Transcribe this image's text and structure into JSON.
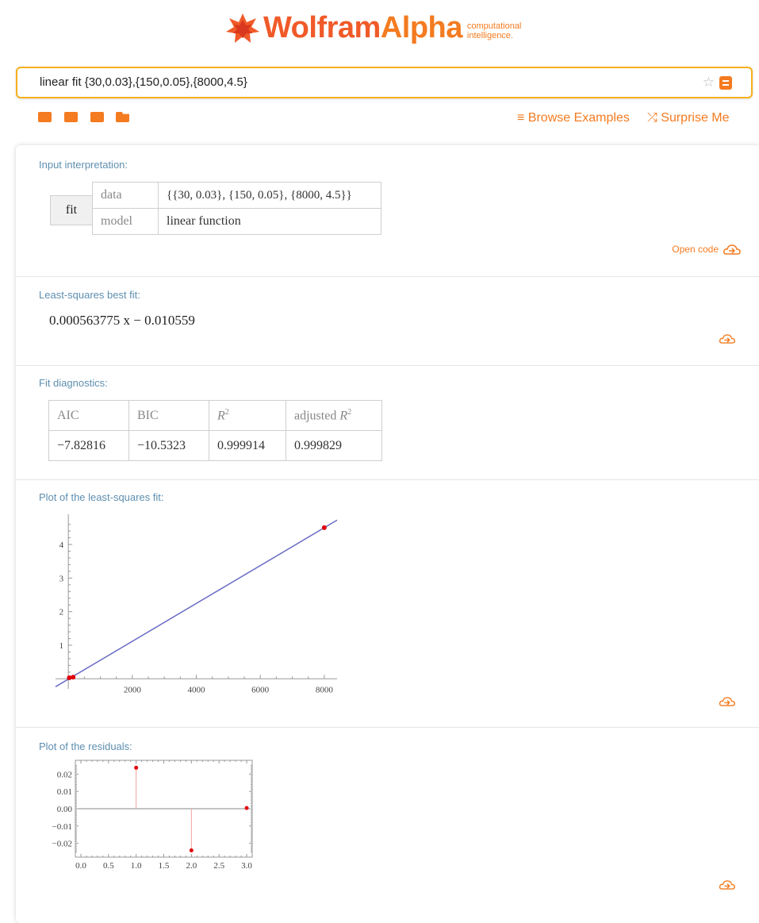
{
  "header": {
    "logo_word_1": "Wolfram",
    "logo_word_2": "Alpha",
    "tagline_1": "computational",
    "tagline_2": "intelligence.",
    "brand_color": "#f05a28",
    "accent_color": "#f47b20"
  },
  "search": {
    "value": "linear fit {30,0.03},{150,0.05},{8000,4.5}"
  },
  "toolbar": {
    "icons": [
      "keyboard-icon",
      "camera-icon",
      "table-icon",
      "folder-icon"
    ],
    "browse_label": "Browse Examples",
    "surprise_label": "Surprise Me"
  },
  "pods": {
    "input": {
      "title": "Input interpretation:",
      "fit_label": "fit",
      "data_label": "data",
      "data_value": "{{30, 0.03}, {150, 0.05}, {8000, 4.5}}",
      "model_label": "model",
      "model_value": "linear function",
      "open_code": "Open code"
    },
    "best_fit": {
      "title": "Least-squares best fit:",
      "expression": "0.000563775 x − 0.010559"
    },
    "diagnostics": {
      "title": "Fit diagnostics:",
      "headers": [
        "AIC",
        "BIC",
        "R2",
        "adjusted R2"
      ],
      "values": [
        "−7.82816",
        "−10.5323",
        "0.999914",
        "0.999829"
      ]
    },
    "plot_fit": {
      "title": "Plot of the least-squares fit:"
    },
    "plot_residuals": {
      "title": "Plot of the residuals:"
    }
  },
  "chart_data": [
    {
      "type": "scatter",
      "title": "",
      "xlabel": "",
      "ylabel": "",
      "x_ticks": [
        "2000",
        "4000",
        "6000",
        "8000"
      ],
      "y_ticks": [
        "1",
        "2",
        "3",
        "4"
      ],
      "points": [
        [
          30,
          0.03
        ],
        [
          150,
          0.05
        ],
        [
          8000,
          4.5
        ]
      ],
      "fit_line": {
        "slope": 0.000563775,
        "intercept": -0.010559
      },
      "xlim": [
        -400,
        8400
      ],
      "ylim": [
        -0.3,
        4.9
      ],
      "point_color": "#e0000b",
      "line_color": "#6a6bc6"
    },
    {
      "type": "scatter",
      "title": "",
      "xlabel": "",
      "ylabel": "",
      "x_ticks": [
        "0.0",
        "0.5",
        "1.0",
        "1.5",
        "2.0",
        "2.5",
        "3.0"
      ],
      "y_ticks": [
        "0.02",
        "0.01",
        "0.00",
        "−0.01",
        "−0.02"
      ],
      "points": [
        [
          1,
          0.0237
        ],
        [
          2,
          -0.0241
        ],
        [
          3,
          0.0004
        ]
      ],
      "xlim": [
        -0.1,
        3.1
      ],
      "ylim": [
        -0.028,
        0.028
      ],
      "point_color": "#e0000b",
      "stem_color": "#f2a0a0"
    }
  ]
}
